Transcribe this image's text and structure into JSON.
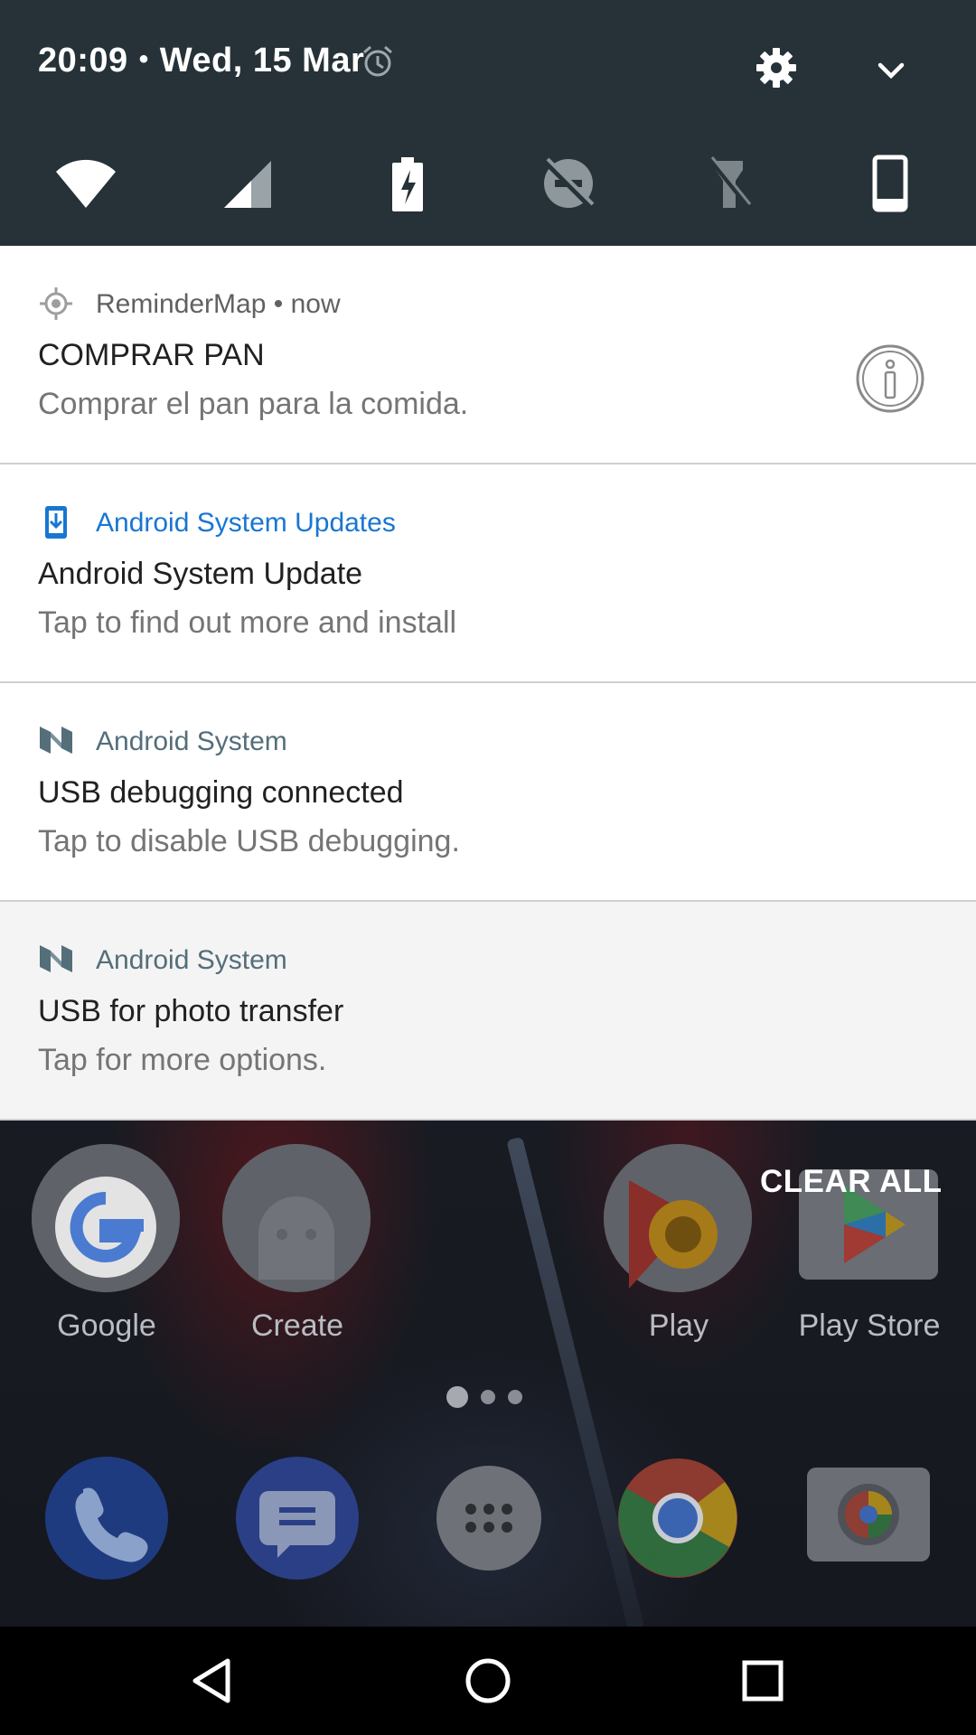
{
  "status": {
    "time": "20:09",
    "separator": "•",
    "date": "Wed, 15 Mar"
  },
  "quick_settings": [
    {
      "icon": "wifi-icon"
    },
    {
      "icon": "cellular-signal-icon"
    },
    {
      "icon": "battery-saver-icon"
    },
    {
      "icon": "do-not-disturb-off-icon"
    },
    {
      "icon": "flashlight-off-icon"
    },
    {
      "icon": "auto-rotate-portrait-icon"
    }
  ],
  "notifications": [
    {
      "app": "ReminderMap",
      "time": "• now",
      "title": "COMPRAR PAN",
      "body": "Comprar el pan para la comida.",
      "icon": "location-crosshair-icon"
    },
    {
      "app": "Android System Updates",
      "title": "Android System Update",
      "body": "Tap to find out more and install",
      "icon": "system-update-icon"
    },
    {
      "app": "Android System",
      "title": "USB debugging connected",
      "body": "Tap to disable USB debugging.",
      "icon": "android-n-icon"
    },
    {
      "app": "Android System",
      "title": "USB for photo transfer",
      "body": "Tap for more options.",
      "icon": "android-n-icon"
    }
  ],
  "clear_all": "CLEAR ALL",
  "home": {
    "apps": [
      {
        "label": "Google",
        "icon": "google-folder-icon"
      },
      {
        "label": "Create",
        "icon": "create-folder-icon"
      },
      {
        "label": "Play",
        "icon": "play-folder-icon"
      },
      {
        "label": "Play Store",
        "icon": "play-store-icon"
      }
    ],
    "dock": [
      {
        "icon": "phone-icon"
      },
      {
        "icon": "messages-icon"
      },
      {
        "icon": "app-drawer-icon"
      },
      {
        "icon": "chrome-icon"
      },
      {
        "icon": "camera-icon"
      }
    ]
  },
  "colors": {
    "header_bg": "#263238",
    "accent_blue": "#1976d2",
    "slate": "#546e7a"
  }
}
